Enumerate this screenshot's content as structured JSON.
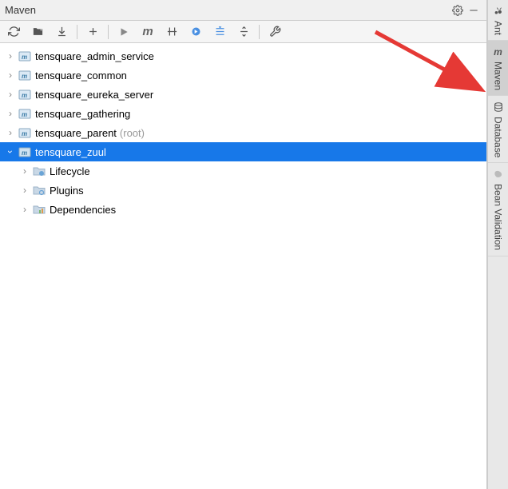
{
  "panel": {
    "title": "Maven"
  },
  "tree": {
    "items": [
      {
        "label": "tensquare_admin_service",
        "suffix": ""
      },
      {
        "label": "tensquare_common",
        "suffix": ""
      },
      {
        "label": "tensquare_eureka_server",
        "suffix": ""
      },
      {
        "label": "tensquare_gathering",
        "suffix": ""
      },
      {
        "label": "tensquare_parent",
        "suffix": "(root)"
      },
      {
        "label": "tensquare_zuul",
        "suffix": ""
      }
    ],
    "children": [
      {
        "label": "Lifecycle"
      },
      {
        "label": "Plugins"
      },
      {
        "label": "Dependencies"
      }
    ]
  },
  "sideTabs": [
    {
      "label": "Ant"
    },
    {
      "label": "Maven"
    },
    {
      "label": "Database"
    },
    {
      "label": "Bean Validation"
    }
  ]
}
